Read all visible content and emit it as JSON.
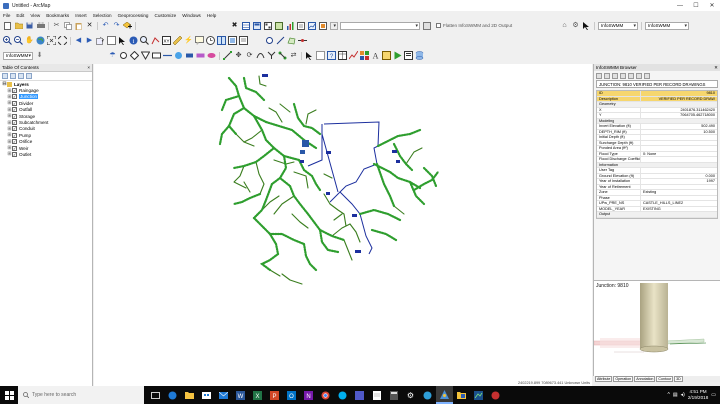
{
  "window": {
    "title": "Untitled - ArcMap"
  },
  "window_buttons": {
    "minimize": "—",
    "maximize": "☐",
    "close": "✕"
  },
  "menu": [
    "File",
    "Edit",
    "View",
    "Bookmarks",
    "Insert",
    "Selection",
    "Geoprocessing",
    "Customize",
    "Windows",
    "Help"
  ],
  "toolbar": {
    "flatten_label": "Flatten InfoSWMM and 2D Output",
    "layer_select": "InfoSWMM",
    "model_select": "InfoSWMM"
  },
  "toc": {
    "title": "Table Of Contents",
    "close_glyph": "×",
    "root": "Layers",
    "layers": [
      {
        "name": "Raingage",
        "selected": false
      },
      {
        "name": "Junction",
        "selected": true
      },
      {
        "name": "Divider",
        "selected": false
      },
      {
        "name": "Outfall",
        "selected": false
      },
      {
        "name": "Storage",
        "selected": false
      },
      {
        "name": "Subcatchment",
        "selected": false
      },
      {
        "name": "Conduit",
        "selected": false
      },
      {
        "name": "Pump",
        "selected": false
      },
      {
        "name": "Orifice",
        "selected": false
      },
      {
        "name": "Weir",
        "selected": false
      },
      {
        "name": "Outlet",
        "selected": false
      }
    ]
  },
  "browser": {
    "title": "InfoSWMM Browser",
    "record": "JUNCTION: 9810 VERIFIED PER RECORD DRAWINGS",
    "rows": [
      {
        "k": "ID",
        "v": "9810",
        "type": "hl"
      },
      {
        "k": "Description",
        "v": "VERIFIED PER RECORD DRAW",
        "type": "hl"
      },
      {
        "k": "Geometry",
        "v": "",
        "type": "cat"
      },
      {
        "k": "X",
        "v": "2401876.311462420",
        "type": ""
      },
      {
        "k": "Y",
        "v": "7064705.462718000",
        "type": ""
      },
      {
        "k": "Modeling",
        "v": "",
        "type": "cat"
      },
      {
        "k": "Invert Elevation (ft)",
        "v": "502.490",
        "type": ""
      },
      {
        "k": "DEPTH_RIM (ft)",
        "v": "10.500",
        "type": ""
      },
      {
        "k": "Initial Depth (ft)",
        "v": "",
        "type": ""
      },
      {
        "k": "Surcharge Depth (ft)",
        "v": "",
        "type": ""
      },
      {
        "k": "Ponded Area (ft²)",
        "v": "",
        "type": ""
      },
      {
        "k": "Flood Type",
        "v": "0: None",
        "type": "vl"
      },
      {
        "k": "Flood Discharge Coefficient",
        "v": "",
        "type": ""
      },
      {
        "k": "Information",
        "v": "",
        "type": "cat"
      },
      {
        "k": "User Tag",
        "v": "",
        "type": ""
      },
      {
        "k": "Ground Elevation (ft)",
        "v": "0.000",
        "type": ""
      },
      {
        "k": "Year of Installation",
        "v": "1997",
        "type": ""
      },
      {
        "k": "Year of Retirement",
        "v": "",
        "type": ""
      },
      {
        "k": "Zone",
        "v": "Existing",
        "type": "vl"
      },
      {
        "k": "Phase",
        "v": "",
        "type": ""
      },
      {
        "k": "UPw_PRE_NS",
        "v": "CASTLE_HILLS_LINE2",
        "type": "vl"
      },
      {
        "k": "MODEL_YEAR",
        "v": "EXISTING",
        "type": "vl"
      },
      {
        "k": "Output",
        "v": "",
        "type": "cat"
      }
    ]
  },
  "preview": {
    "title": "Junction: 9810",
    "tabs": [
      "Attribute",
      "Operation",
      "Annotation",
      "Contour",
      "3D"
    ]
  },
  "status": {
    "coords": "2402219.899  7089673.441 Unknown Units"
  },
  "taskbar": {
    "search_placeholder": "Type here to search",
    "time": "4:51 PM",
    "date": "2/19/2018"
  },
  "colors": {
    "network_green": "#3a7d1e",
    "node_green": "#2e9e2e",
    "boundary_blue": "#1c2f9e",
    "selection_blue": "#3399ff"
  }
}
